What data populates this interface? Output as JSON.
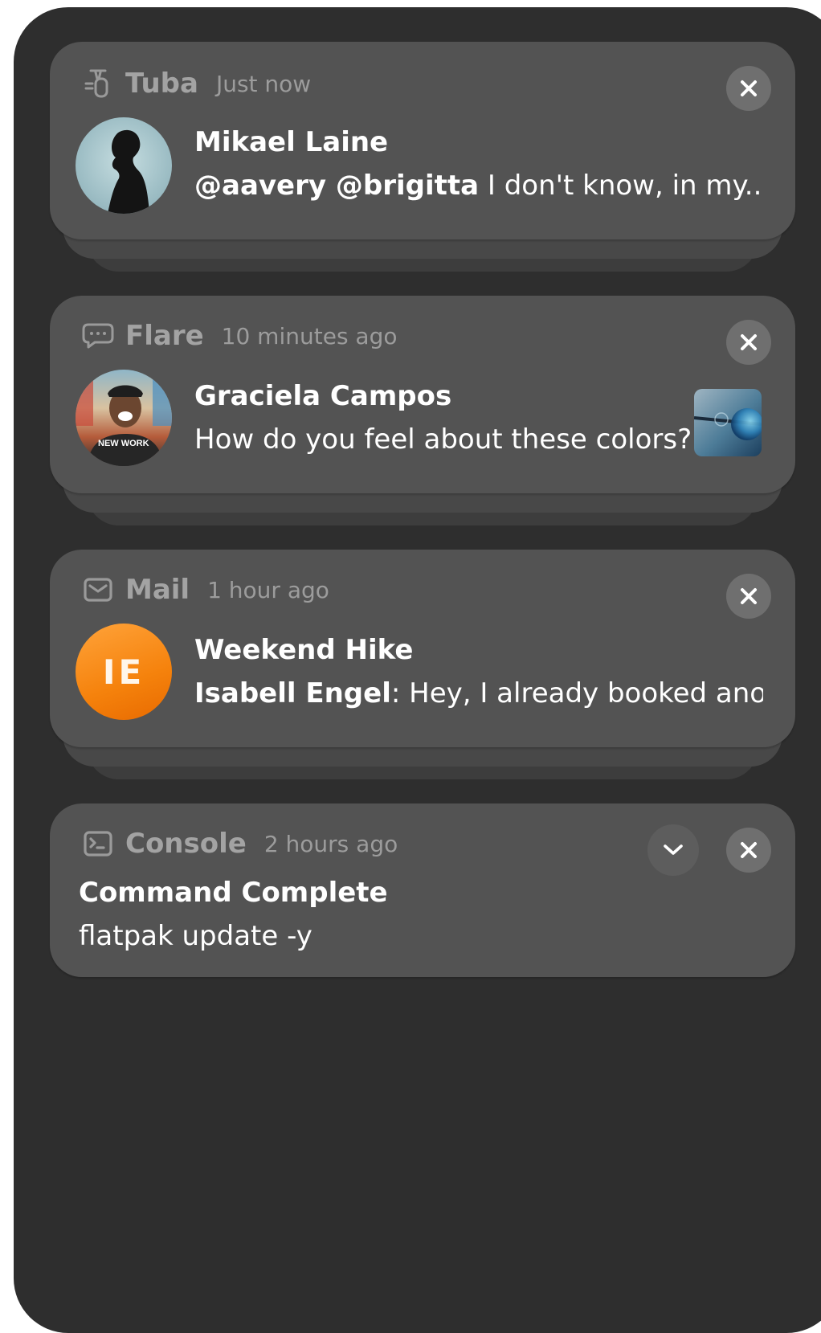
{
  "notifications": [
    {
      "app": "Tuba",
      "time": "Just now",
      "title": "Mikael Laine",
      "body_bold": "@aavery @brigitta",
      "body_text": " I don't know, in my...",
      "icon": "tuba-icon"
    },
    {
      "app": "Flare",
      "time": "10 minutes ago",
      "title": "Graciela Campos",
      "body_text": "How do you feel about these colors?",
      "avatar_shirt_text": "NEW WORK",
      "icon": "chat-bubble-icon"
    },
    {
      "app": "Mail",
      "time": "1 hour ago",
      "title": "Weekend Hike",
      "body_bold": "Isabell Engel",
      "body_text": ": Hey, I already booked ano...",
      "initials": "IE",
      "icon": "mail-icon"
    },
    {
      "app": "Console",
      "time": "2 hours ago",
      "title": "Command Complete",
      "body_text": "flatpak update -y",
      "icon": "terminal-icon"
    }
  ],
  "colors": {
    "panel": "#2e2e2e",
    "card": "#535353",
    "accent_orange": "#f5820c"
  }
}
